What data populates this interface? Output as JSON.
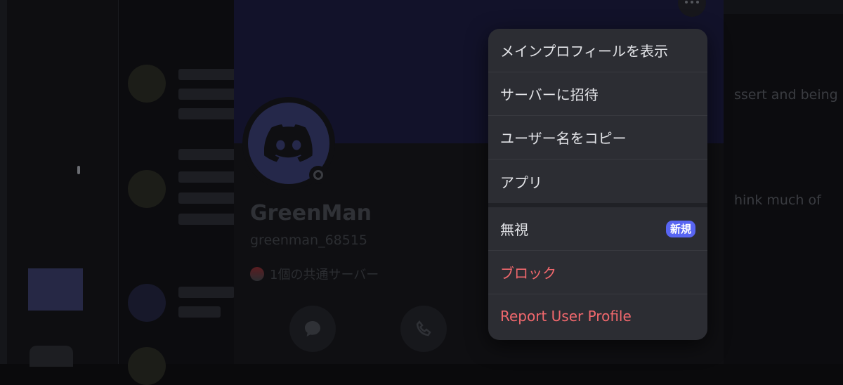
{
  "background": {
    "snippet_right_1": "ssert and being",
    "snippet_right_2": "hink much of"
  },
  "profile": {
    "display_name": "GreenMan",
    "username": "greenman_68515",
    "mutual_servers": "1個の共通サーバー"
  },
  "menu": {
    "items": [
      {
        "label": "メインプロフィールを表示"
      },
      {
        "label": "サーバーに招待"
      },
      {
        "label": "ユーザー名をコピー"
      },
      {
        "label": "アプリ"
      },
      {
        "label": "無視",
        "badge": "新規"
      },
      {
        "label": "ブロック"
      },
      {
        "label": "Report User Profile"
      }
    ]
  },
  "colors": {
    "menu_bg": "#2c2d33",
    "danger": "#f2686d",
    "badge": "#5865f2",
    "banner": "#12122a"
  }
}
